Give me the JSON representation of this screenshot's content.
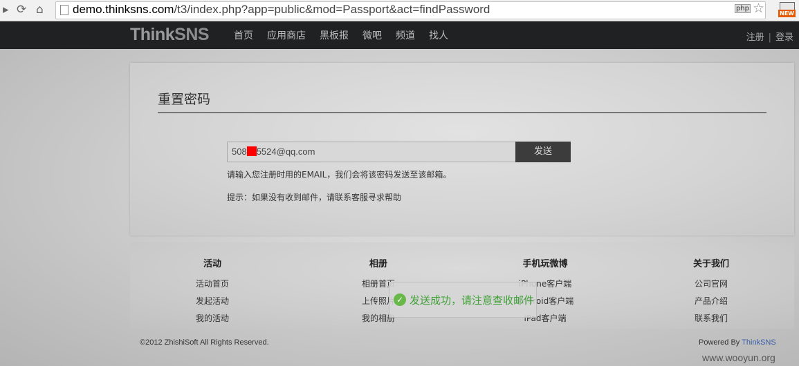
{
  "browser": {
    "url_host": "demo.thinksns.com",
    "url_path": "/t3/index.php?app=public&mod=Passport&act=findPassword",
    "ext_php_label": "php",
    "new_badge_label": "NEW"
  },
  "header": {
    "logo_think": "Think",
    "logo_sns": "SNS",
    "nav": [
      "首页",
      "应用商店",
      "黑板报",
      "微吧",
      "频道",
      "找人"
    ],
    "register": "注册",
    "separator": "|",
    "login": "登录"
  },
  "reset": {
    "title": "重置密码",
    "email_prefix": "508",
    "email_suffix": "5524@qq.com",
    "send_label": "发送",
    "hint_email": "请输入您注册时用的EMAIL，我们会将该密码发送至该邮箱。",
    "hint_help": "提示：如果没有收到邮件，请联系客服寻求帮助"
  },
  "footer": {
    "columns": [
      {
        "title": "活动",
        "links": [
          "活动首页",
          "发起活动",
          "我的活动"
        ]
      },
      {
        "title": "相册",
        "links": [
          "相册首页",
          "上传照片",
          "我的相册"
        ]
      },
      {
        "title": "手机玩微博",
        "links": [
          "iPhone客户端",
          "Android客户端",
          "iPad客户端"
        ]
      },
      {
        "title": "关于我们",
        "links": [
          "公司官网",
          "产品介绍",
          "联系我们"
        ]
      }
    ],
    "copyright": "©2012 ZhishiSoft All Rights Reserved.",
    "powered_prefix": "Powered By ",
    "powered_brand": "ThinkSNS"
  },
  "toast": {
    "message": "发送成功，请注意查收邮件"
  },
  "watermark": "www.wooyun.org",
  "colors": {
    "header_bg": "#1f2123",
    "toast_text": "#3fa037",
    "powered_brand": "#3a5ea8"
  }
}
